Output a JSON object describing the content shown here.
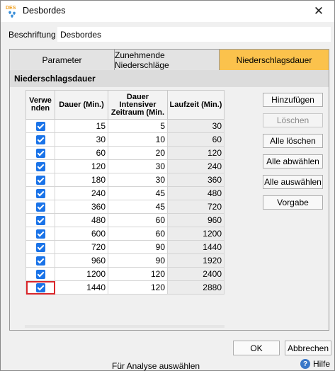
{
  "window": {
    "title": "Desbordes",
    "icon_text": "DES"
  },
  "form": {
    "label": "Beschriftung",
    "value": "Desbordes"
  },
  "tabs": [
    {
      "label": "Parameter",
      "active": false
    },
    {
      "label": "Zunehmende Niederschläge",
      "active": false
    },
    {
      "label": "Niederschlagsdauer",
      "active": true
    }
  ],
  "section": {
    "title": "Niederschlagsdauer"
  },
  "table": {
    "headers": [
      "Verwenden",
      "Dauer (Min.)",
      "Dauer Intensiver Zeitraum (Min.",
      "Laufzeit (Min.)"
    ],
    "rows": [
      {
        "use": true,
        "dauer": "15",
        "intensiv": "5",
        "laufzeit": "30"
      },
      {
        "use": true,
        "dauer": "30",
        "intensiv": "10",
        "laufzeit": "60"
      },
      {
        "use": true,
        "dauer": "60",
        "intensiv": "20",
        "laufzeit": "120"
      },
      {
        "use": true,
        "dauer": "120",
        "intensiv": "30",
        "laufzeit": "240"
      },
      {
        "use": true,
        "dauer": "180",
        "intensiv": "30",
        "laufzeit": "360"
      },
      {
        "use": true,
        "dauer": "240",
        "intensiv": "45",
        "laufzeit": "480"
      },
      {
        "use": true,
        "dauer": "360",
        "intensiv": "45",
        "laufzeit": "720"
      },
      {
        "use": true,
        "dauer": "480",
        "intensiv": "60",
        "laufzeit": "960"
      },
      {
        "use": true,
        "dauer": "600",
        "intensiv": "60",
        "laufzeit": "1200"
      },
      {
        "use": true,
        "dauer": "720",
        "intensiv": "90",
        "laufzeit": "1440"
      },
      {
        "use": true,
        "dauer": "960",
        "intensiv": "90",
        "laufzeit": "1920"
      },
      {
        "use": true,
        "dauer": "1200",
        "intensiv": "120",
        "laufzeit": "2400"
      },
      {
        "use": true,
        "dauer": "1440",
        "intensiv": "120",
        "laufzeit": "2880"
      }
    ]
  },
  "side_buttons": {
    "add": "Hinzufügen",
    "delete": "Löschen",
    "delete_all": "Alle löschen",
    "deselect_all": "Alle abwählen",
    "select_all": "Alle auswählen",
    "default": "Vorgabe"
  },
  "footer": {
    "ok": "OK",
    "cancel": "Abbrechen",
    "status": "Für Analyse auswählen",
    "help": "Hilfe"
  },
  "colors": {
    "active_tab": "#fbc24c",
    "checkbox": "#1a73e8",
    "selection": "#d9272b"
  }
}
